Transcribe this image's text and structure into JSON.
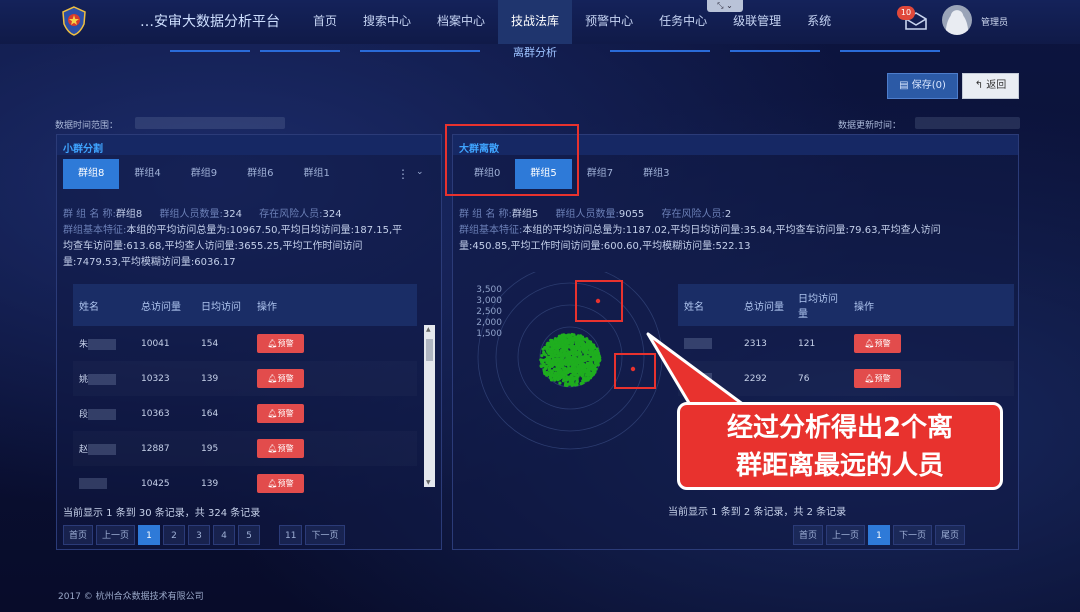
{
  "header": {
    "app_title": "…安审大数据分析平台",
    "nav": [
      "首页",
      "搜索中心",
      "档案中心",
      "技战法库",
      "预警中心",
      "任务中心",
      "级联管理",
      "系统"
    ],
    "active_nav": "技战法库",
    "notification_count": "10",
    "user_name": "管理员"
  },
  "page": {
    "title": "离群分析",
    "save_label": "保存(0)",
    "back_label": "返回",
    "time_range_label": "数据时间范围：",
    "update_time_label": "数据更新时间："
  },
  "left_panel": {
    "title": "小群分割",
    "tabs": [
      "群组8",
      "群组4",
      "群组9",
      "群组6",
      "群组1"
    ],
    "active_tab": "群组8",
    "group_name_label": "群 组 名 称:",
    "group_name": "群组8",
    "member_count_label": "群组人员数量:",
    "member_count": "324",
    "risk_label": "存在风险人员:",
    "risk_count": "324",
    "feature_label": "群组基本特征:",
    "feature_lines": [
      "本组的平均访问总量为:10967.50,平均日均访问量:187.15,平",
      "均查车访问量:613.68,平均查人访问量:3655.25,平均工作时间访问",
      "量:7479.53,平均模糊访问量:6036.17"
    ],
    "columns": [
      "姓名",
      "总访问量",
      "日均访问",
      "操作"
    ],
    "rows": [
      {
        "name": "朱",
        "total": "10041",
        "daily": "154"
      },
      {
        "name": "姚",
        "total": "10323",
        "daily": "139"
      },
      {
        "name": "段",
        "total": "10363",
        "daily": "164"
      },
      {
        "name": "赵",
        "total": "12887",
        "daily": "195"
      },
      {
        "name": "",
        "total": "10425",
        "daily": "139"
      }
    ],
    "action_label": "预警",
    "record_text": "当前显示 1 条到 30 条记录，共 324 条记录",
    "pager": [
      "首页",
      "上一页",
      "1",
      "2",
      "3",
      "4",
      "5",
      "11",
      "下一页"
    ],
    "pager_active": "1"
  },
  "right_panel": {
    "title": "大群离散",
    "tabs": [
      "群组0",
      "群组5",
      "群组7",
      "群组3"
    ],
    "active_tab": "群组5",
    "group_name_label": "群 组 名 称:",
    "group_name": "群组5",
    "member_count_label": "群组人员数量:",
    "member_count": "9055",
    "risk_label": "存在风险人员:",
    "risk_count": "2",
    "feature_label": "群组基本特征:",
    "feature_lines": [
      "本组的平均访问总量为:1187.02,平均日均访问量:35.84,平均查车访问量:79.63,平均查人访问",
      "量:450.85,平均工作时间访问量:600.60,平均模糊访问量:522.13"
    ],
    "chart_axis_labels": [
      "3,500",
      "3,000",
      "2,500",
      "2,000",
      "1,500"
    ],
    "columns": [
      "姓名",
      "总访问量",
      "日均访问量",
      "操作"
    ],
    "rows": [
      {
        "name": "",
        "total": "2313",
        "daily": "121"
      },
      {
        "name": "",
        "total": "2292",
        "daily": "76"
      }
    ],
    "action_label": "预警",
    "record_text": "当前显示 1 条到 2 条记录，共 2 条记录",
    "pager": [
      "首页",
      "上一页",
      "1",
      "下一页",
      "尾页"
    ],
    "pager_active": "1"
  },
  "annotation": {
    "line1": "经过分析得出2个离",
    "line2": "群距离最远的人员"
  },
  "footer": "2017 © 杭州合众数据技术有限公司",
  "colors": {
    "accent": "#2e7ad8",
    "alarm": "#e24c4c",
    "highlight": "#e8322e",
    "cluster": "#1fae1f"
  }
}
